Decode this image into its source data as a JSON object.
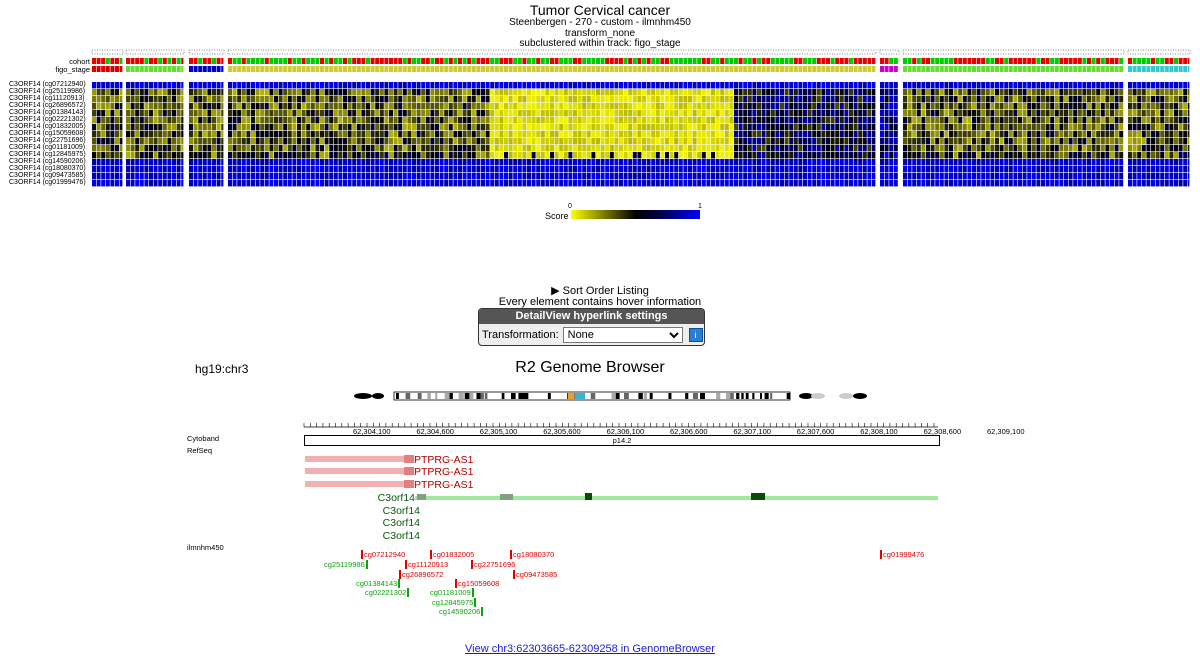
{
  "heatmap": {
    "title": "Tumor Cervical cancer",
    "subtitle1": "Steenbergen - 270 - custom - ilmnhm450",
    "subtitle2": "transform_none",
    "subtitle3": "subclustered within track: figo_stage",
    "track_labels": [
      "cohort",
      "figo_stage"
    ],
    "row_labels": [
      "C3ORF14 (cg07212940)",
      "C3ORF14 (cg25119986)",
      "C3ORF14 (cg11120913)",
      "C3ORF14 (cg26896572)",
      "C3ORF14 (cg01384143)",
      "C3ORF14 (cg02221302)",
      "C3ORF14 (cg01832005)",
      "C3ORF14 (cg15059608)",
      "C3ORF14 (cg22751696)",
      "C3ORF14 (cg01181009)",
      "C3ORF14 (cg12845975)",
      "C3ORF14 (cg14590206)",
      "C3ORF14 (cg18080370)",
      "C3ORF14 (cg09473585)",
      "C3ORF14 (cg01999476)"
    ],
    "colors": {
      "low": "#ffff00",
      "mid": "#000000",
      "high": "#0000ff",
      "cohort_red": "#e60000",
      "cohort_green": "#00cc00",
      "figo_yellow": "#cccc33",
      "figo_red": "#dd0000",
      "figo_blue": "#0000cc",
      "figo_green": "#66dd33",
      "figo_magenta": "#cc00cc",
      "figo_cyan": "#33cccc"
    },
    "legend": {
      "label": "Score",
      "min": "0",
      "max": "1"
    }
  },
  "controls": {
    "sort_listing": "▶ Sort Order Listing",
    "hover_info": "Every element contains hover information",
    "detailview_title": "DetailView hyperlink settings",
    "transformation_label": "Transformation:",
    "transformation_value": "None",
    "info_icon": "i"
  },
  "genome_browser": {
    "locus": "hg19:chr3",
    "title": "R2 Genome Browser",
    "cytoband_label": "Cytoband",
    "refseq_label": "RefSeq",
    "probe_track_label": "ilmnhm450",
    "band_name": "p14.2",
    "ticks": [
      "62,304,100",
      "62,304,600",
      "62,305,100",
      "62,305,600",
      "62,306,100",
      "62,306,600",
      "62,307,100",
      "62,307,600",
      "62,308,100",
      "62,308,600",
      "62,309,100"
    ],
    "red_genes": [
      "PTPRG-AS1",
      "PTPRG-AS1",
      "PTPRG-AS1"
    ],
    "green_genes": [
      "C3orf14",
      "C3orf14",
      "C3orf14",
      "C3orf14"
    ],
    "probes": {
      "cg07212940": "cg07212940",
      "cg01832005": "cg01832005",
      "cg18080370": "cg18080370",
      "cg01999476": "cg01999476",
      "cg25119986": "cg25119986",
      "cg11120913": "cg11120913",
      "cg22751696": "cg22751696",
      "cg26896572": "cg26896572",
      "cg09473585": "cg09473585",
      "cg01384143": "cg01384143",
      "cg15059608": "cg15059608",
      "cg02221302": "cg02221302",
      "cg01181009": "cg01181009",
      "cg12845975": "cg12845975",
      "cg14590206": "cg14590206"
    },
    "link": "View chr3:62303665-62309258 in GenomeBrowser"
  }
}
